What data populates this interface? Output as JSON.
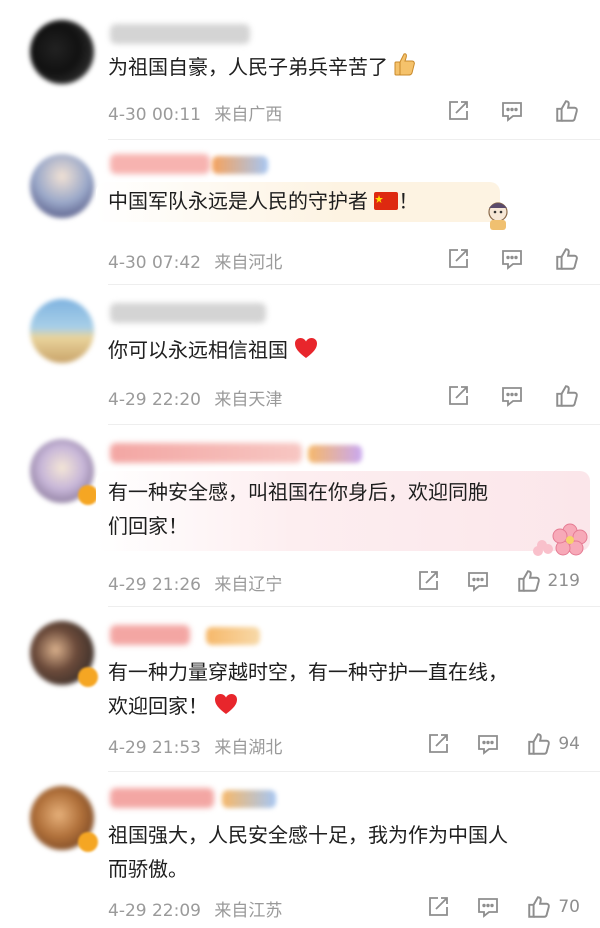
{
  "comments": [
    {
      "text": "为祖国自豪，人民子弟兵辛苦了",
      "time": "4-30 00:11",
      "location": "来自广西",
      "likes": ""
    },
    {
      "text": "中国军队永远是人民的守护者",
      "text_suffix": "！",
      "time": "4-30 07:42",
      "location": "来自河北",
      "likes": ""
    },
    {
      "text": "你可以永远相信祖国",
      "time": "4-29 22:20",
      "location": "来自天津",
      "likes": ""
    },
    {
      "line1": "有一种安全感，叫祖国在你身后，欢迎同胞",
      "line2": "们回家！",
      "time": "4-29 21:26",
      "location": "来自辽宁",
      "likes": "219"
    },
    {
      "line1": "有一种力量穿越时空，有一种守护一直在线，",
      "line2": "欢迎回家！",
      "time": "4-29 21:53",
      "location": "来自湖北",
      "likes": "94"
    },
    {
      "line1": "祖国强大，人民安全感十足，我为作为中国人",
      "line2": "而骄傲。",
      "time": "4-29 22:09",
      "location": "来自江苏",
      "likes": "70"
    }
  ],
  "icons": {
    "share": "share-icon",
    "comment": "comment-icon",
    "like": "thumbs-up-icon",
    "thumb_emoji": "thumbs-up-emoji",
    "flag": "china-flag-emoji",
    "heart": "red-heart-emoji",
    "flowers": "cherry-blossom-sticker"
  },
  "colors": {
    "meta": "#9a9a9a",
    "text": "#1e1e1e",
    "heart": "#e8262c",
    "bubble_yellow": "#fdf3e2",
    "bubble_pink": "#fdeef0"
  }
}
